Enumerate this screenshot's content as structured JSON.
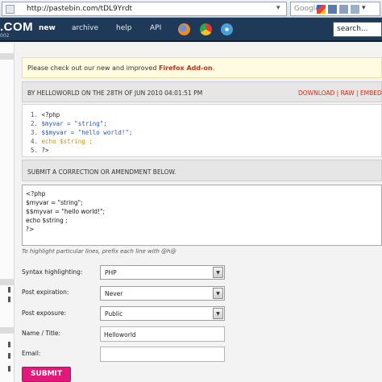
{
  "browser": {
    "url": "http://pastebin.com/tDL9Yrdt",
    "search_placeholder": "Google"
  },
  "header": {
    "logo": ".COM",
    "logo_sub": "002",
    "nav": [
      "new",
      "archive",
      "help",
      "API"
    ],
    "search_placeholder": "search..."
  },
  "notice": {
    "prefix": "Please check out our new and improved ",
    "link": "Firefox Add-on",
    "suffix": "."
  },
  "paste": {
    "meta": "BY HELLOWORLD ON THE 28TH OF JUN 2010 04:01:51 PM",
    "actions": "DOWNLOAD | RAW | EMBED |",
    "lines": [
      {
        "num": "1.",
        "code": "<?php"
      },
      {
        "num": "2.",
        "code": "$myvar = \"string\";"
      },
      {
        "num": "3.",
        "code": "$$myvar = \"hello world!\";"
      },
      {
        "num": "4.",
        "code": "echo $string ;"
      },
      {
        "num": "5.",
        "code": "?>"
      }
    ]
  },
  "correction": {
    "heading": "SUBMIT A CORRECTION OR AMENDMENT BELOW.",
    "lines": [
      "<?php",
      "$myvar = \"string\";",
      "$$myvar = \"hello world!\";",
      "echo $string ;",
      "?>"
    ],
    "hint": "To highlight particular lines, prefix each line with @h@"
  },
  "form": {
    "syntax_label": "Syntax highlighting:",
    "syntax_value": "PHP",
    "expiration_label": "Post expiration:",
    "expiration_value": "Never",
    "exposure_label": "Post exposure:",
    "exposure_value": "Public",
    "name_label": "Name / Title:",
    "name_value": "Helloworld",
    "email_label": "Email:",
    "email_value": "",
    "submit_label": "SUBMIT"
  }
}
